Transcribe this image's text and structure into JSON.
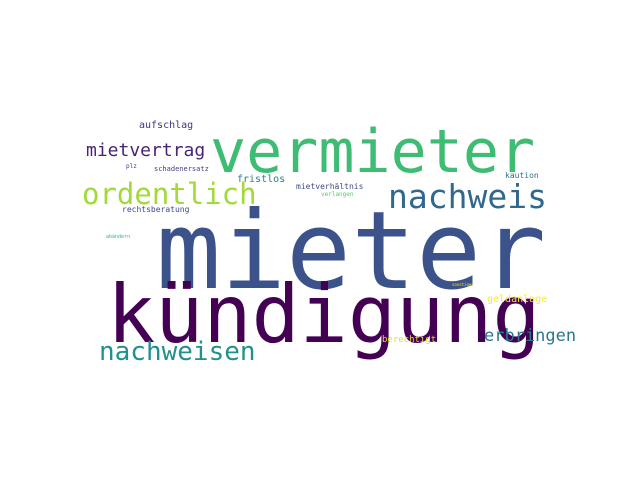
{
  "words": [
    {
      "text": "mieter",
      "color": "#3b528b"
    },
    {
      "text": "kündigung",
      "color": "#440154"
    },
    {
      "text": "vermieter",
      "color": "#3fbc73"
    },
    {
      "text": "nachweis",
      "color": "#31688e"
    },
    {
      "text": "ordentlich",
      "color": "#a2d93b"
    },
    {
      "text": "nachweisen",
      "color": "#21918c"
    },
    {
      "text": "mietvertrag",
      "color": "#482475"
    },
    {
      "text": "erbringen",
      "color": "#2a788e"
    },
    {
      "text": "aufschlag",
      "color": "#46337f"
    },
    {
      "text": "geldanlage",
      "color": "#fde725"
    },
    {
      "text": "fristlos",
      "color": "#277f8e"
    },
    {
      "text": "mietverhältnis",
      "color": "#3e4a89"
    },
    {
      "text": "kaution",
      "color": "#2c728e"
    },
    {
      "text": "rechtsberatung",
      "color": "#3e4989"
    },
    {
      "text": "berechtigt",
      "color": "#dde318"
    },
    {
      "text": "schadenersatz",
      "color": "#433e85"
    },
    {
      "text": "verlangen",
      "color": "#5ec962"
    },
    {
      "text": "abändern",
      "color": "#35b779"
    },
    {
      "text": "plz",
      "color": "#453781"
    },
    {
      "text": "sonstiges",
      "color": "#fde725"
    }
  ]
}
